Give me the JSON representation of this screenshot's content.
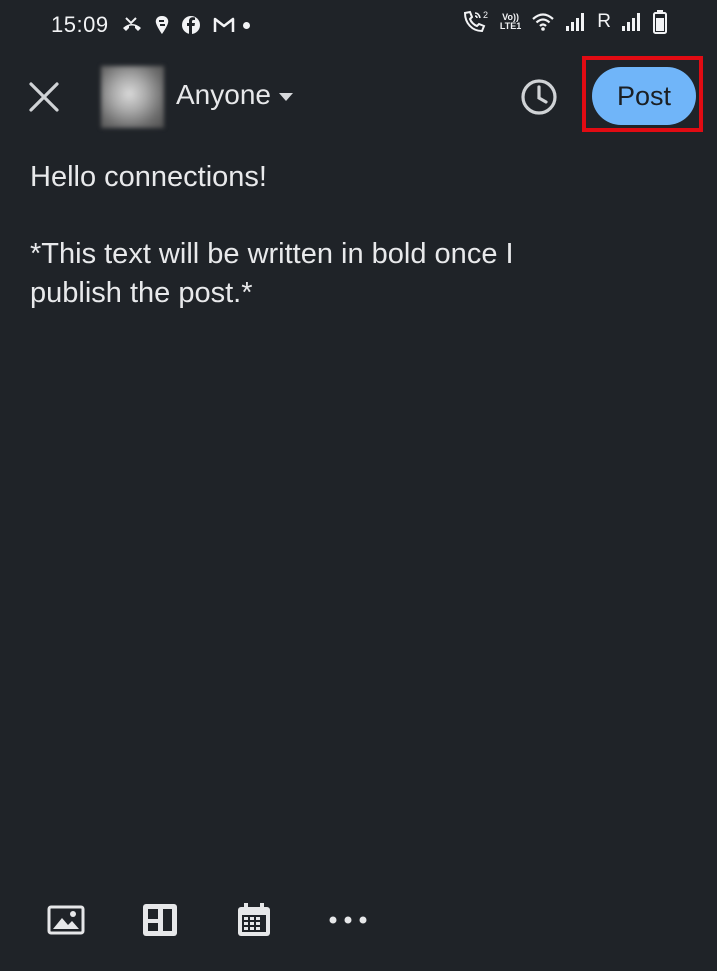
{
  "status_bar": {
    "time": "15:09",
    "left_icons": [
      "missed-call-icon",
      "swiggy-icon",
      "facebook-icon",
      "gmail-icon",
      "notification-dot-icon"
    ],
    "volte_label": "Vo))\nLTE1",
    "sim_superscript": "2",
    "roaming_label": "R",
    "right_icons": [
      "call-icon",
      "volte-icon",
      "wifi-icon",
      "signal-icon",
      "signal-icon-2",
      "battery-icon"
    ]
  },
  "header": {
    "close_icon": "close-icon",
    "audience_label": "Anyone",
    "schedule_icon": "clock-icon",
    "post_label": "Post"
  },
  "composer": {
    "line1": "Hello connections!",
    "line2": "*This text will be written in bold once I\npublish the post.*"
  },
  "toolbar": {
    "items": [
      "image-icon",
      "template-icon",
      "calendar-icon",
      "more-icon"
    ]
  },
  "colors": {
    "background": "#1f2328",
    "post_button": "#70b5f9",
    "highlight": "#e10b13",
    "text": "#e8e9eb"
  }
}
